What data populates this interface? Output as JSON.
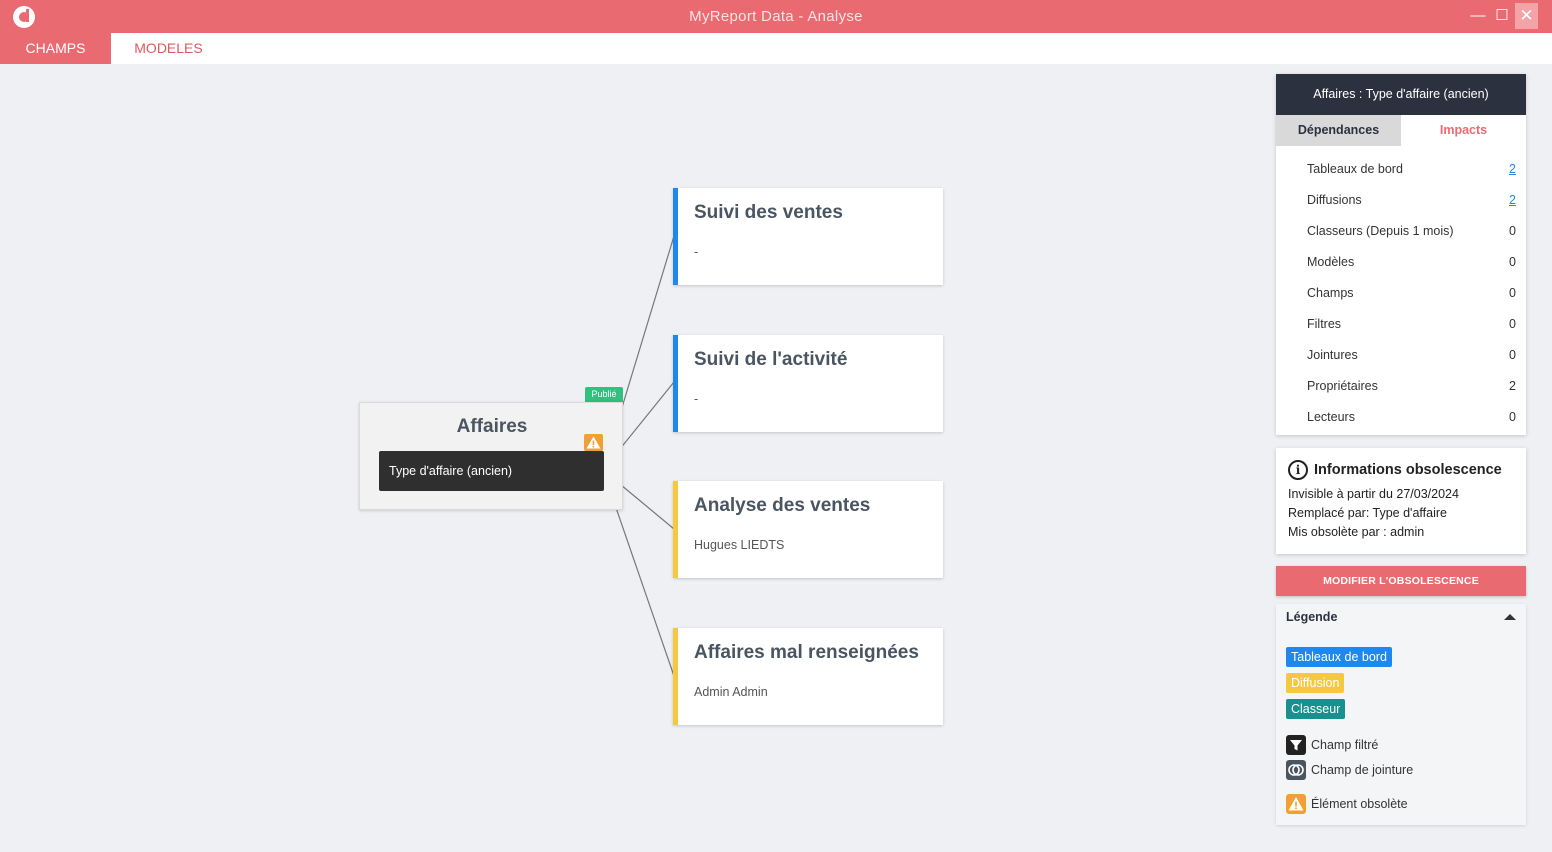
{
  "window": {
    "title": "MyReport Data - Analyse",
    "minimize": "—",
    "maximize": "☐",
    "close": "✕"
  },
  "menu": {
    "tabs": [
      "CHAMPS",
      "MODELES"
    ]
  },
  "source": {
    "badge": "Publié",
    "title": "Affaires",
    "field": "Type d'affaire (ancien)"
  },
  "cards": [
    {
      "title": "Suivi des ventes",
      "subtitle": "-",
      "color": "#1e87f0"
    },
    {
      "title": "Suivi de l'activité",
      "subtitle": "-",
      "color": "#1e87f0"
    },
    {
      "title": "Analyse des ventes",
      "subtitle": "Hugues LIEDTS",
      "color": "#f5c842"
    },
    {
      "title": "Affaires mal renseignées",
      "subtitle": "Admin Admin",
      "color": "#f5c842"
    }
  ],
  "panel": {
    "header": "Affaires : Type d'affaire (ancien)",
    "tabs": {
      "dependances": "Dépendances",
      "impacts": "Impacts"
    },
    "rows": [
      {
        "label": "Tableaux de bord",
        "count": "2"
      },
      {
        "label": "Diffusions",
        "count": "2"
      },
      {
        "label": "Classeurs (Depuis 1 mois)",
        "count": "0"
      },
      {
        "label": "Modèles",
        "count": "0"
      },
      {
        "label": "Champs",
        "count": "0"
      },
      {
        "label": "Filtres",
        "count": "0"
      },
      {
        "label": "Jointures",
        "count": "0"
      },
      {
        "label": "Propriétaires",
        "count": "2"
      },
      {
        "label": "Lecteurs",
        "count": "0"
      }
    ]
  },
  "obsolescence": {
    "title": "Informations obsolescence",
    "icon": "i",
    "lines": [
      "Invisible à partir du 27/03/2024",
      "Remplacé par: Type d'affaire",
      "Mis obsolète par : admin"
    ],
    "button": "MODIFIER L'OBSOLESCENCE"
  },
  "legend": {
    "title": "Légende",
    "tags": [
      "Tableaux de bord",
      "Diffusion",
      "Classeur"
    ],
    "items": [
      "Champ filtré",
      "Champ de jointure",
      "Élément obsolète"
    ]
  },
  "colors": {
    "accent": "#e96b71",
    "dark": "#2c3140",
    "blue": "#1e87f0",
    "yellow": "#f5c842",
    "teal": "#17918f",
    "warning": "#f3a033",
    "published": "#2ec27e"
  }
}
